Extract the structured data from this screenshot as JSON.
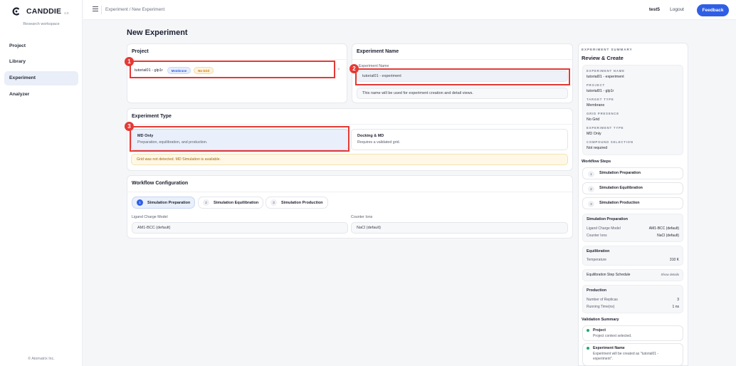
{
  "app": {
    "logo_text": "CANDDIE",
    "version": "2.0",
    "workspace": "Research workspace",
    "footer": "© Atomatrix Inc."
  },
  "sidebar": {
    "items": [
      {
        "label": "Project",
        "active": false
      },
      {
        "label": "Library",
        "active": false
      },
      {
        "label": "Experiment",
        "active": true
      },
      {
        "label": "Analyzer",
        "active": false
      }
    ]
  },
  "topbar": {
    "breadcrumb": "Experiment / New Experiment",
    "user": "test5",
    "logout": "Logout",
    "feedback": "Feedback"
  },
  "page": {
    "title": "New Experiment"
  },
  "project_card": {
    "title": "Project",
    "project_name": "tutorial01 - glp1r",
    "badge_target": "Membrane",
    "badge_grid": "No Grid",
    "remove": "×"
  },
  "name_card": {
    "title": "Experiment Name",
    "field_label": "Experiment Name",
    "value": "tutorial01 - experiment",
    "hint": "This name will be used for experiment creation and detail views."
  },
  "type_card": {
    "title": "Experiment Type",
    "options": [
      {
        "title": "MD Only",
        "desc": "Preparation, equilibration, and production.",
        "selected": true
      },
      {
        "title": "Docking & MD",
        "desc": "Requires a validated grid.",
        "selected": false
      }
    ],
    "warning": "Grid was not detected. MD Simulation is available."
  },
  "workflow_card": {
    "title": "Workflow Configuration",
    "tabs": [
      {
        "num": "1",
        "label": "Simulation Preparation",
        "active": true
      },
      {
        "num": "2",
        "label": "Simulation Equilibration",
        "active": false
      },
      {
        "num": "3",
        "label": "Simulation Production",
        "active": false
      }
    ],
    "ligand_label": "Ligand Charge Model",
    "ligand_value": "AM1-BCC (default)",
    "counter_label": "Counter Ions",
    "counter_value": "NaCl (default)"
  },
  "annotations": [
    "1",
    "2",
    "3"
  ],
  "summary": {
    "kicker": "EXPERIMENT SUMMARY",
    "title": "Review & Create",
    "fields": [
      {
        "key": "EXPERIMENT NAME",
        "value": "tutorial01 - experiment"
      },
      {
        "key": "PROJECT",
        "value": "tutorial01 - glp1r"
      },
      {
        "key": "TARGET TYPE",
        "value": "Membrane"
      },
      {
        "key": "GRID PRESENCE",
        "value": "No Grid"
      },
      {
        "key": "EXPERIMENT TYPE",
        "value": "MD Only"
      },
      {
        "key": "COMPOUND SELECTION",
        "value": "Not required"
      }
    ],
    "workflow_steps_title": "Workflow Steps",
    "steps": [
      {
        "num": "1",
        "label": "Simulation Preparation"
      },
      {
        "num": "2",
        "label": "Simulation Equilibration"
      },
      {
        "num": "3",
        "label": "Simulation Production"
      }
    ],
    "prep": {
      "title": "Simulation Preparation",
      "rows": [
        {
          "label": "Ligand Charge Model",
          "value": "AM1-BCC (default)"
        },
        {
          "label": "Counter Ions",
          "value": "NaCl (default)"
        }
      ]
    },
    "equil": {
      "title": "Equilibration",
      "temp_label": "Temperature",
      "temp_value": "310 K"
    },
    "schedule": {
      "label": "Equilibration Step Schedule",
      "action": "Show details"
    },
    "production": {
      "title": "Production",
      "rows": [
        {
          "label": "Number of Replicas",
          "value": "3"
        },
        {
          "label": "Running Time(ns)",
          "value": "1 ns"
        }
      ]
    },
    "validation_title": "Validation Summary",
    "validation": [
      {
        "title": "Project",
        "desc": "Project context selected."
      },
      {
        "title": "Experiment Name",
        "desc": "Experiment will be created as \"tutorial01 - experiment\"."
      }
    ]
  },
  "colors": {
    "accent": "#2f5fe4",
    "annotation": "#e53935",
    "success": "#1faa6b",
    "warning_bg": "#fff8e6"
  }
}
